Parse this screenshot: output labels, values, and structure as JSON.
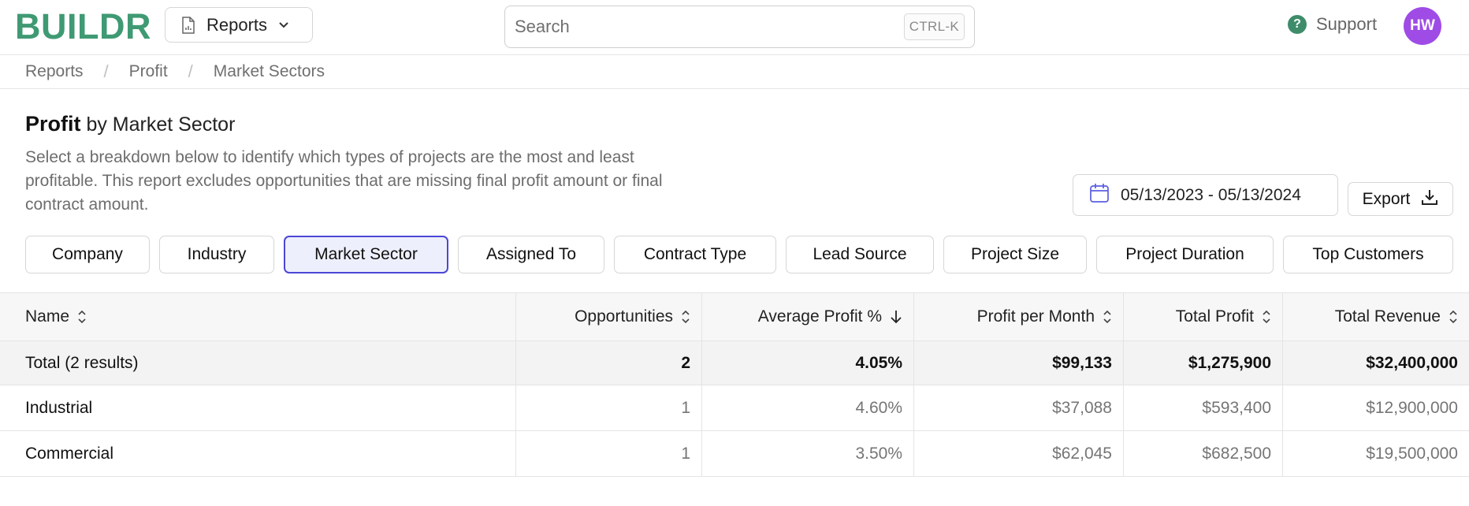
{
  "header": {
    "logo": "BUILDR",
    "reports_dropdown_label": "Reports",
    "search_placeholder": "Search",
    "search_shortcut": "CTRL-K",
    "support_label": "Support",
    "avatar_initials": "HW"
  },
  "breadcrumb": [
    "Reports",
    "Profit",
    "Market Sectors"
  ],
  "page": {
    "title_bold": "Profit",
    "title_rest": "by Market Sector",
    "description": "Select a breakdown below to identify which types of projects are the most and least profitable. This report excludes opportunities that are missing final profit amount or final contract amount.",
    "date_range": "05/13/2023 - 05/13/2024",
    "export_label": "Export"
  },
  "tabs": {
    "items": [
      "Company",
      "Industry",
      "Market Sector",
      "Assigned To",
      "Contract Type",
      "Lead Source",
      "Project Size",
      "Project Duration",
      "Top Customers"
    ],
    "active": "Market Sector"
  },
  "table": {
    "columns": [
      "Name",
      "Opportunities",
      "Average Profit %",
      "Profit per Month",
      "Total Profit",
      "Total Revenue"
    ],
    "total": [
      "Total (2 results)",
      "2",
      "4.05%",
      "$99,133",
      "$1,275,900",
      "$32,400,000"
    ],
    "rows": [
      [
        "Industrial",
        "1",
        "4.60%",
        "$37,088",
        "$593,400",
        "$12,900,000"
      ],
      [
        "Commercial",
        "1",
        "3.50%",
        "$62,045",
        "$682,500",
        "$19,500,000"
      ]
    ]
  },
  "colors": {
    "brand": "#3f9a73",
    "active_tab_border": "#4b47d6",
    "avatar": "#9f4ce6"
  },
  "icons": {
    "reports_dropdown": "report-document-icon",
    "dropdown": "chevron-down-icon",
    "support": "help-circle-icon",
    "date": "calendar-icon",
    "export": "download-icon",
    "sort": "sort-icon",
    "sorted_desc": "arrow-down-icon"
  }
}
